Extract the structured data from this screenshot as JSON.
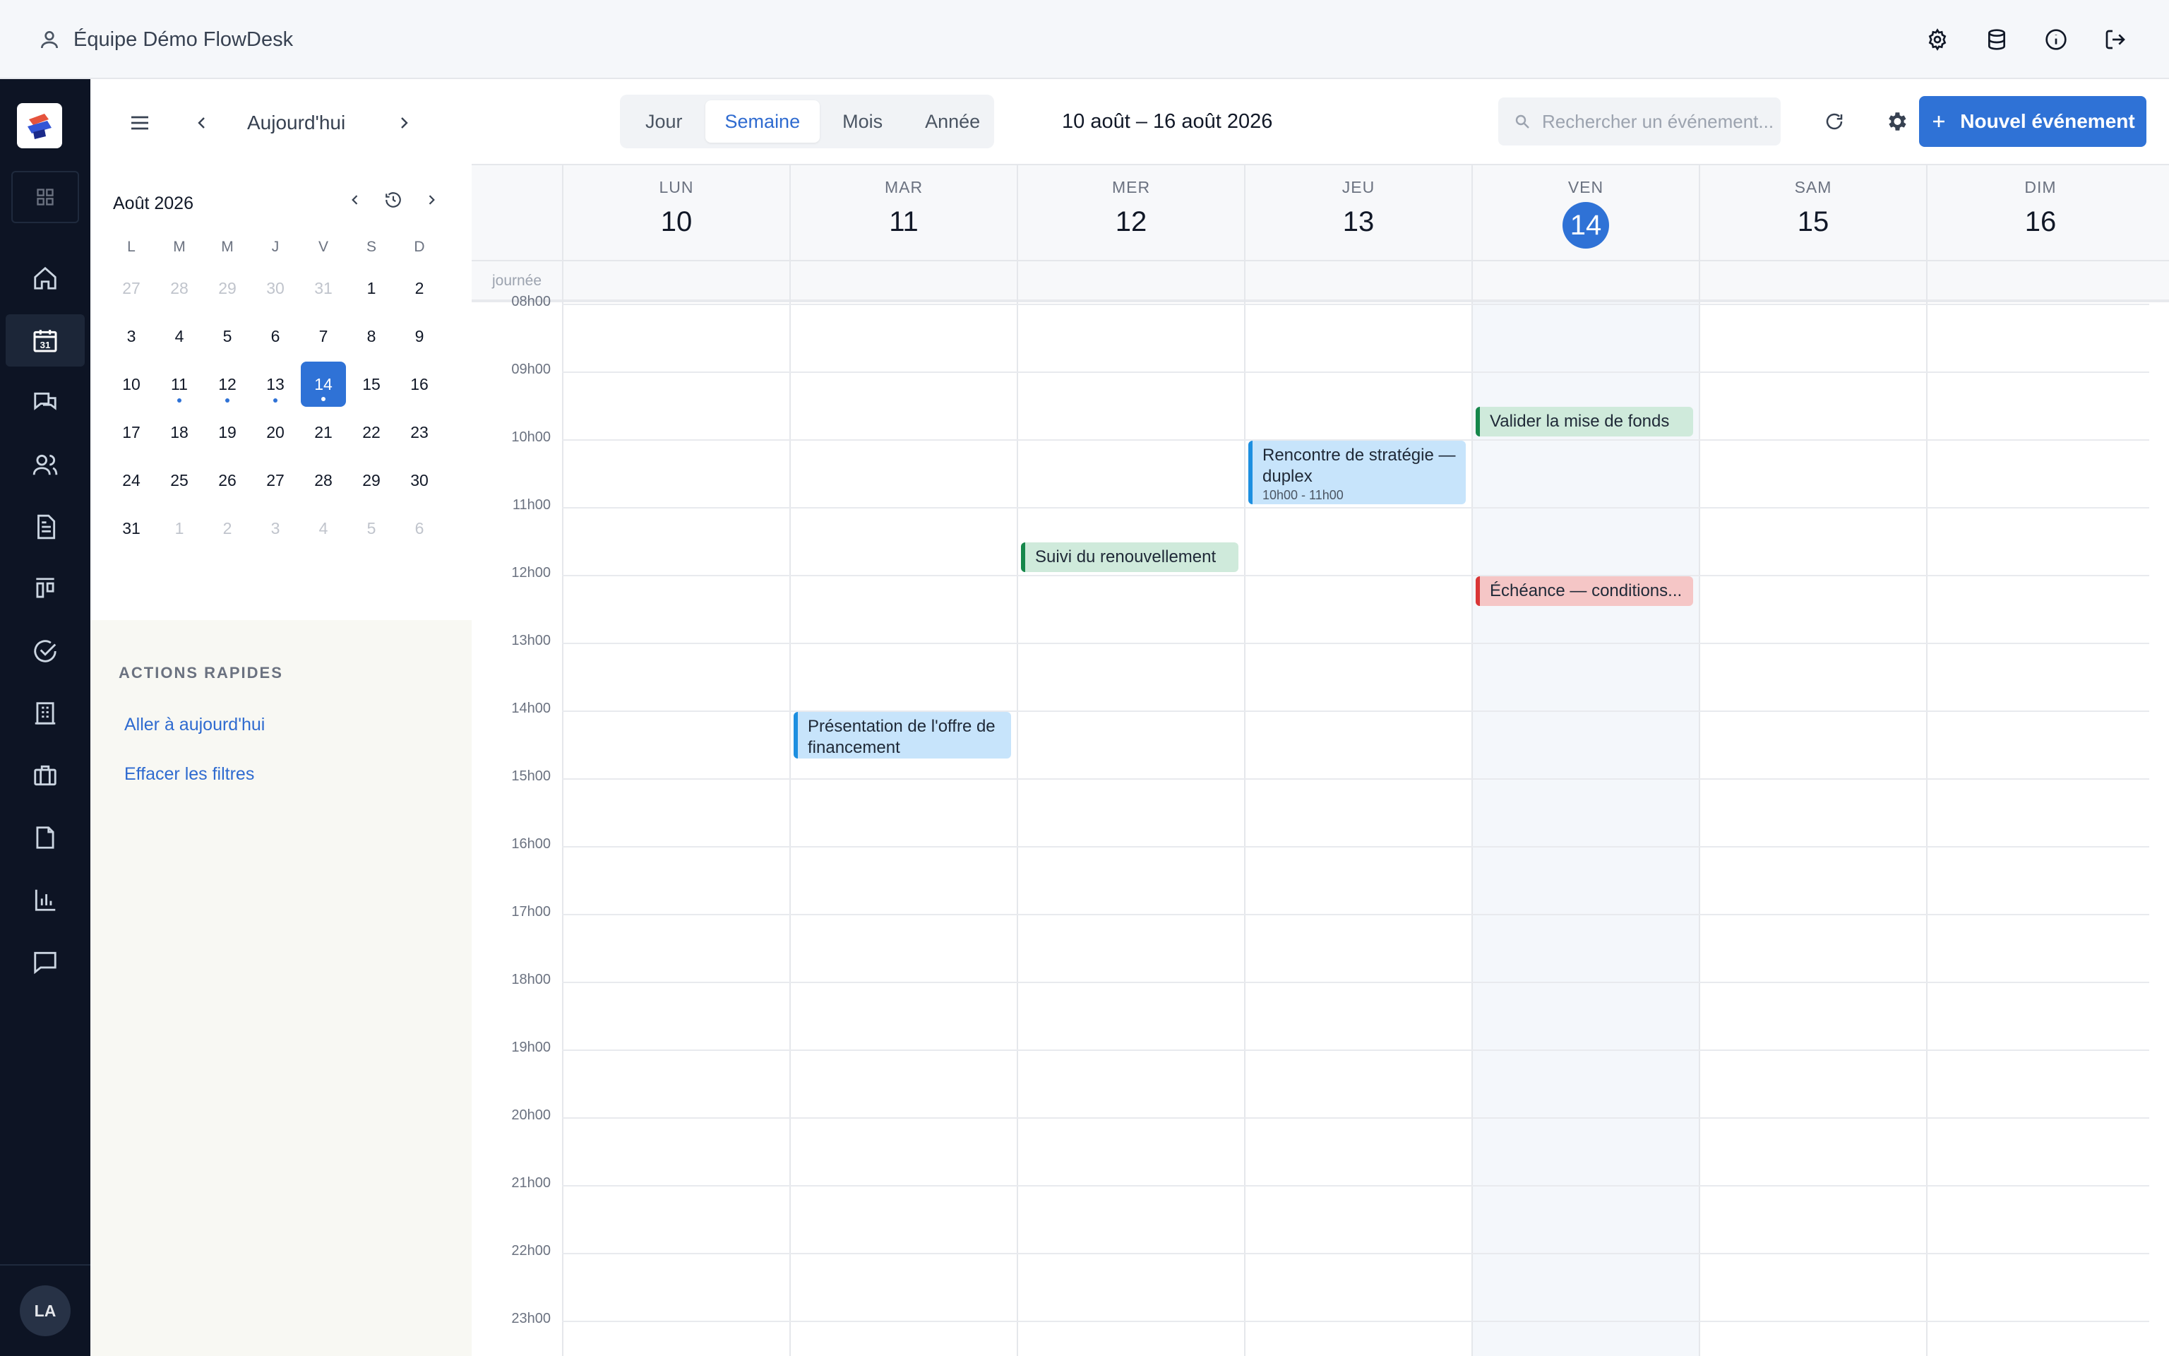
{
  "topbar": {
    "team_name": "Équipe Démo FlowDesk",
    "icons": [
      "settings-icon",
      "database-icon",
      "info-icon",
      "logout-icon"
    ]
  },
  "rail": {
    "nav_icons": [
      "home-icon",
      "calendar-icon",
      "chat-icon",
      "users-icon",
      "document-icon",
      "board-icon",
      "check-circle-icon",
      "building-icon",
      "briefcase-icon",
      "file-icon",
      "bar-chart-icon",
      "message-icon"
    ],
    "active_index": 1,
    "avatar_initials": "LA"
  },
  "nav": {
    "today_label": "Aujourd'hui"
  },
  "views": {
    "day": "Jour",
    "week": "Semaine",
    "month": "Mois",
    "year": "Année",
    "active": "Semaine"
  },
  "range_label": "10 août – 16 août 2026",
  "search": {
    "placeholder": "Rechercher un événement..."
  },
  "new_event_label": "Nouvel événement",
  "mini_calendar": {
    "title": "Août 2026",
    "weekdays": [
      "L",
      "M",
      "M",
      "J",
      "V",
      "S",
      "D"
    ],
    "days": [
      {
        "n": "27",
        "other": true
      },
      {
        "n": "28",
        "other": true
      },
      {
        "n": "29",
        "other": true
      },
      {
        "n": "30",
        "other": true
      },
      {
        "n": "31",
        "other": true
      },
      {
        "n": "1"
      },
      {
        "n": "2"
      },
      {
        "n": "3"
      },
      {
        "n": "4"
      },
      {
        "n": "5"
      },
      {
        "n": "6"
      },
      {
        "n": "7"
      },
      {
        "n": "8"
      },
      {
        "n": "9"
      },
      {
        "n": "10"
      },
      {
        "n": "11",
        "dot": true
      },
      {
        "n": "12",
        "dot": true
      },
      {
        "n": "13",
        "dot": true
      },
      {
        "n": "14",
        "dot": true,
        "selected": true
      },
      {
        "n": "15"
      },
      {
        "n": "16"
      },
      {
        "n": "17"
      },
      {
        "n": "18"
      },
      {
        "n": "19"
      },
      {
        "n": "20"
      },
      {
        "n": "21"
      },
      {
        "n": "22"
      },
      {
        "n": "23"
      },
      {
        "n": "24"
      },
      {
        "n": "25"
      },
      {
        "n": "26"
      },
      {
        "n": "27"
      },
      {
        "n": "28"
      },
      {
        "n": "29"
      },
      {
        "n": "30"
      },
      {
        "n": "31"
      },
      {
        "n": "1",
        "other": true
      },
      {
        "n": "2",
        "other": true
      },
      {
        "n": "3",
        "other": true
      },
      {
        "n": "4",
        "other": true
      },
      {
        "n": "5",
        "other": true
      },
      {
        "n": "6",
        "other": true
      }
    ]
  },
  "quick_actions": {
    "title": "ACTIONS RAPIDES",
    "go_today": "Aller à aujourd'hui",
    "clear_filters": "Effacer les filtres"
  },
  "week": {
    "allday_label": "journée",
    "days": [
      {
        "name": "LUN",
        "num": "10"
      },
      {
        "name": "MAR",
        "num": "11"
      },
      {
        "name": "MER",
        "num": "12"
      },
      {
        "name": "JEU",
        "num": "13"
      },
      {
        "name": "VEN",
        "num": "14",
        "today": true
      },
      {
        "name": "SAM",
        "num": "15"
      },
      {
        "name": "DIM",
        "num": "16"
      }
    ],
    "hours": [
      "08h00",
      "09h00",
      "10h00",
      "11h00",
      "12h00",
      "13h00",
      "14h00",
      "15h00",
      "16h00",
      "17h00",
      "18h00",
      "19h00",
      "20h00",
      "21h00",
      "22h00",
      "23h00"
    ]
  },
  "events": [
    {
      "title": "Valider la mise de fonds",
      "day": 4,
      "start": 9.5,
      "end": 10.0,
      "color": "green"
    },
    {
      "title": "Rencontre de stratégie — duplex",
      "time": "10h00 - 11h00",
      "day": 3,
      "start": 10.0,
      "end": 11.0,
      "color": "blue"
    },
    {
      "title": "Suivi du renouvellement",
      "day": 2,
      "start": 11.5,
      "end": 12.0,
      "color": "green"
    },
    {
      "title": "Échéance — conditions...",
      "day": 4,
      "start": 12.0,
      "end": 12.5,
      "color": "red"
    },
    {
      "title": "Présentation de l'offre de financement",
      "day": 1,
      "start": 14.0,
      "end": 14.75,
      "color": "blue"
    }
  ]
}
